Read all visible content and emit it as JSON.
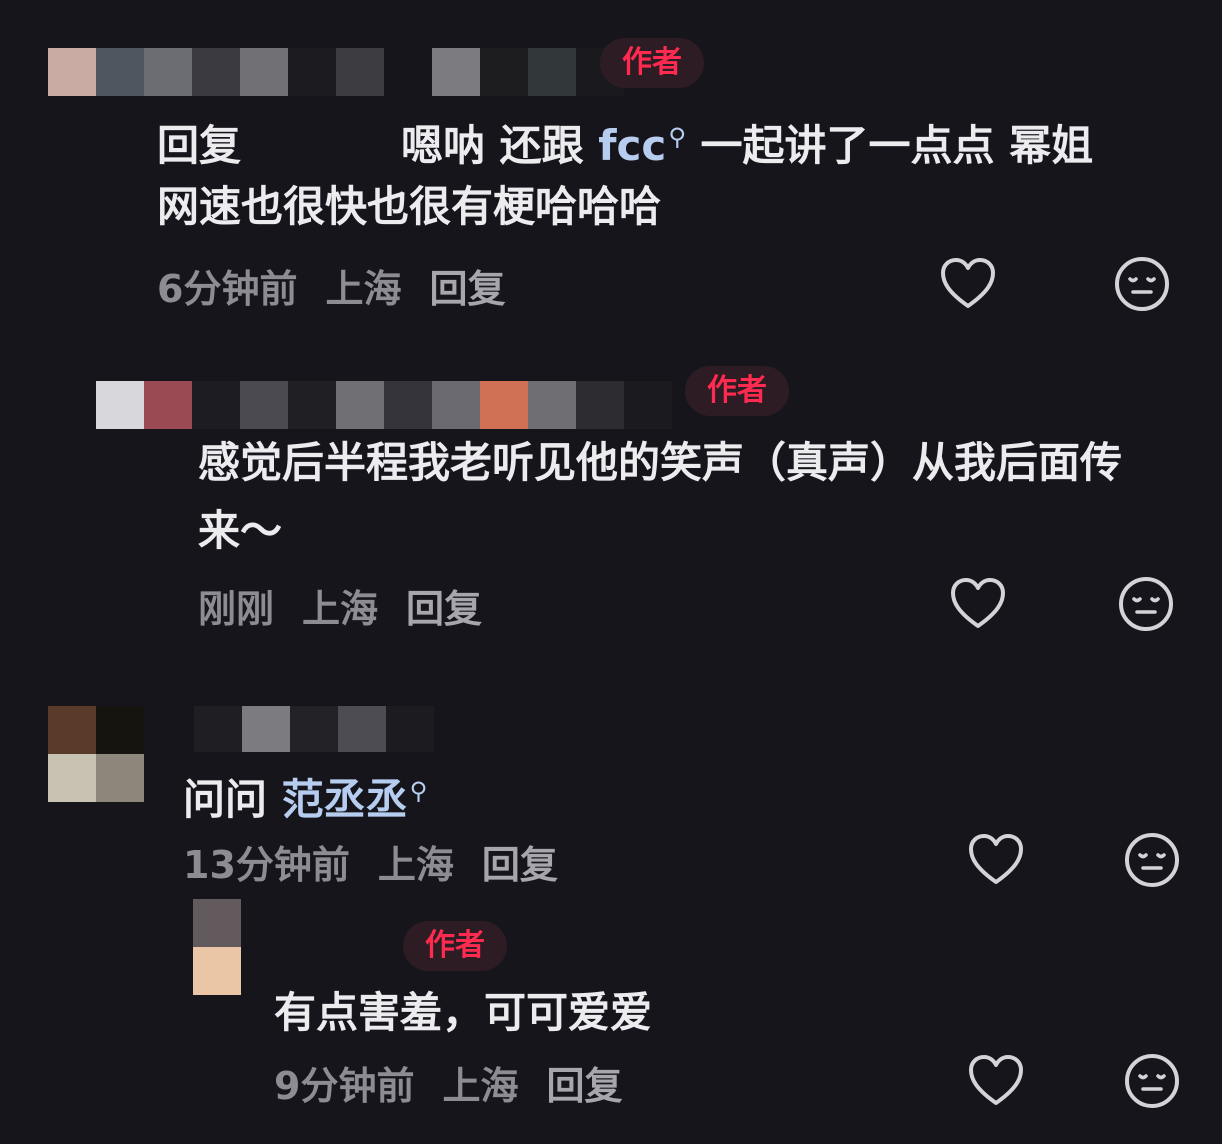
{
  "comments": [
    {
      "badge": "作者",
      "reply_prefix": "回复",
      "text_a": "嗯呐 还跟 ",
      "mention": "fcc",
      "text_b": " 一起讲了一点点 幂姐",
      "text_line2": "网速也很快也很有梗哈哈哈",
      "time": "6分钟前",
      "location": "上海",
      "reply": "回复"
    },
    {
      "badge": "作者",
      "text_line1": "感觉后半程我老听见他的笑声（真声）从我后面传",
      "text_line2": "来～",
      "time": "刚刚",
      "location": "上海",
      "reply": "回复"
    },
    {
      "text_a": "问问 ",
      "mention": "范丞丞",
      "time": "13分钟前",
      "location": "上海",
      "reply": "回复"
    },
    {
      "badge": "作者",
      "text_line1": "有点害羞，可可爱爱",
      "time": "9分钟前",
      "location": "上海",
      "reply": "回复"
    }
  ],
  "icons": {
    "like": "heart-icon",
    "dislike": "neutral-face-icon",
    "mention_search": "search-icon"
  },
  "colors": {
    "background": "#16151c",
    "author_badge": "#ff2a50",
    "mention": "#b6cdf0",
    "meta": "#8d8c93"
  }
}
